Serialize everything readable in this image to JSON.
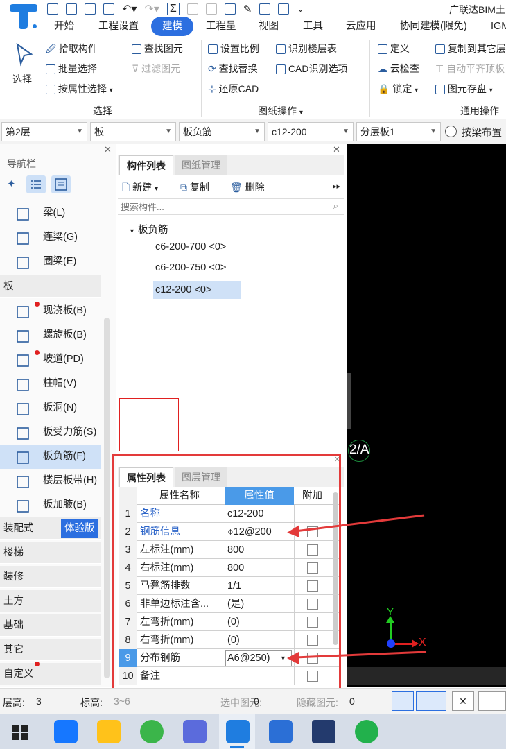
{
  "app": {
    "title": "广联达BIM土",
    "quick_toolbar_more": "⌄"
  },
  "menu": {
    "tabs": [
      "开始",
      "工程设置",
      "建模",
      "工程量",
      "视图",
      "工具",
      "云应用",
      "协同建模(限免)",
      "IGM"
    ],
    "active_index": 2
  },
  "ribbon": {
    "select_label": "选择",
    "select_group": {
      "items": [
        "拾取构件",
        "批量选择",
        "按属性选择",
        "查找图元",
        "过滤图元"
      ],
      "group_label": "选择"
    },
    "drawing_group": {
      "items": [
        "设置比例",
        "查找替换",
        "还原CAD",
        "识别楼层表",
        "CAD识别选项"
      ],
      "group_label": "图纸操作"
    },
    "general_group": {
      "items": [
        "定义",
        "云检查",
        "锁定",
        "复制到其它层",
        "自动平齐顶板",
        "图元存盘"
      ],
      "group_label": "通用操作"
    }
  },
  "filters": {
    "floor": "第2层",
    "category": "板",
    "type": "板负筋",
    "spec": "c12-200",
    "layer": "分层板1",
    "radio_label": "按梁布置"
  },
  "nav": {
    "title": "导航栏",
    "items_beam": [
      {
        "label": "梁(L)",
        "icon": "beam-icon"
      },
      {
        "label": "连梁(G)",
        "icon": "link-beam-icon"
      },
      {
        "label": "圈梁(E)",
        "icon": "ring-beam-icon"
      }
    ],
    "slab_category": "板",
    "items_slab": [
      {
        "label": "现浇板(B)",
        "icon": "cast-slab-icon",
        "dot": true
      },
      {
        "label": "螺旋板(B)",
        "icon": "spiral-slab-icon",
        "dot": false
      },
      {
        "label": "坡道(PD)",
        "icon": "ramp-icon",
        "dot": true
      },
      {
        "label": "柱帽(V)",
        "icon": "column-cap-icon",
        "dot": false
      },
      {
        "label": "板洞(N)",
        "icon": "slab-hole-icon",
        "dot": false
      },
      {
        "label": "板受力筋(S)",
        "icon": "slab-rebar-icon",
        "dot": false
      },
      {
        "label": "板负筋(F)",
        "icon": "negative-rebar-icon",
        "dot": false,
        "selected": true
      },
      {
        "label": "楼层板带(H)",
        "icon": "slab-strip-icon",
        "dot": false
      },
      {
        "label": "板加腋(B)",
        "icon": "slab-haunch-icon",
        "dot": false
      }
    ],
    "prefab_category": "装配式",
    "prefab_badge": "体验版",
    "categories": [
      "楼梯",
      "装修",
      "土方",
      "基础",
      "其它",
      "自定义"
    ]
  },
  "component_panel": {
    "tabs": [
      "构件列表",
      "图纸管理"
    ],
    "toolbar": {
      "new": "新建",
      "copy": "复制",
      "delete": "删除"
    },
    "search_placeholder": "搜索构件...",
    "group": "板负筋",
    "items": [
      "c6-200-700 <0>",
      "c6-200-750 <0>",
      "c12-200 <0>"
    ],
    "selected_index": 2
  },
  "property_panel": {
    "tabs": [
      "属性列表",
      "图层管理"
    ],
    "headers": [
      "属性名称",
      "属性值",
      "附加"
    ],
    "rows": [
      {
        "num": "1",
        "name": "名称",
        "value": "c12-200",
        "blue": true,
        "checkbox": false
      },
      {
        "num": "2",
        "name": "钢筋信息",
        "value": "⌽12@200",
        "blue": true,
        "checkbox": true
      },
      {
        "num": "3",
        "name": "左标注(mm)",
        "value": "800",
        "blue": false,
        "checkbox": true
      },
      {
        "num": "4",
        "name": "右标注(mm)",
        "value": "800",
        "blue": false,
        "checkbox": true
      },
      {
        "num": "5",
        "name": "马凳筋排数",
        "value": "1/1",
        "blue": false,
        "checkbox": true
      },
      {
        "num": "6",
        "name": "非单边标注含...",
        "value": "(是)",
        "blue": false,
        "checkbox": true
      },
      {
        "num": "7",
        "name": "左弯折(mm)",
        "value": "(0)",
        "blue": false,
        "checkbox": true
      },
      {
        "num": "8",
        "name": "右弯折(mm)",
        "value": "(0)",
        "blue": false,
        "checkbox": true
      },
      {
        "num": "9",
        "name": "分布钢筋",
        "value": "A6@250)",
        "blue": false,
        "checkbox": true
      },
      {
        "num": "10",
        "name": "备注",
        "value": "",
        "blue": false,
        "checkbox": true
      }
    ],
    "editing_row_num": "9"
  },
  "canvas": {
    "axis_label": "2/A",
    "axis_x": "X",
    "axis_y": "Y"
  },
  "status_bar": {
    "floor_height_label": "层高:",
    "floor_height_value": "3",
    "elevation_label": "标高:",
    "elevation_value": "3~6",
    "selected_label": "选中图元:",
    "selected_value": "0",
    "hidden_label": "隐藏图元:",
    "hidden_value": "0"
  },
  "taskbar": {
    "apps": [
      "windows-start",
      "app-blue-mountain",
      "app-yellow-cloud",
      "app-green-refresh",
      "app-purple-A",
      "app-glodon-T",
      "app-doc",
      "app-cad",
      "app-wechat"
    ]
  },
  "colors": {
    "accent": "#2c6fe0",
    "highlight_red": "#e02020",
    "canvas_bg": "#000000"
  }
}
